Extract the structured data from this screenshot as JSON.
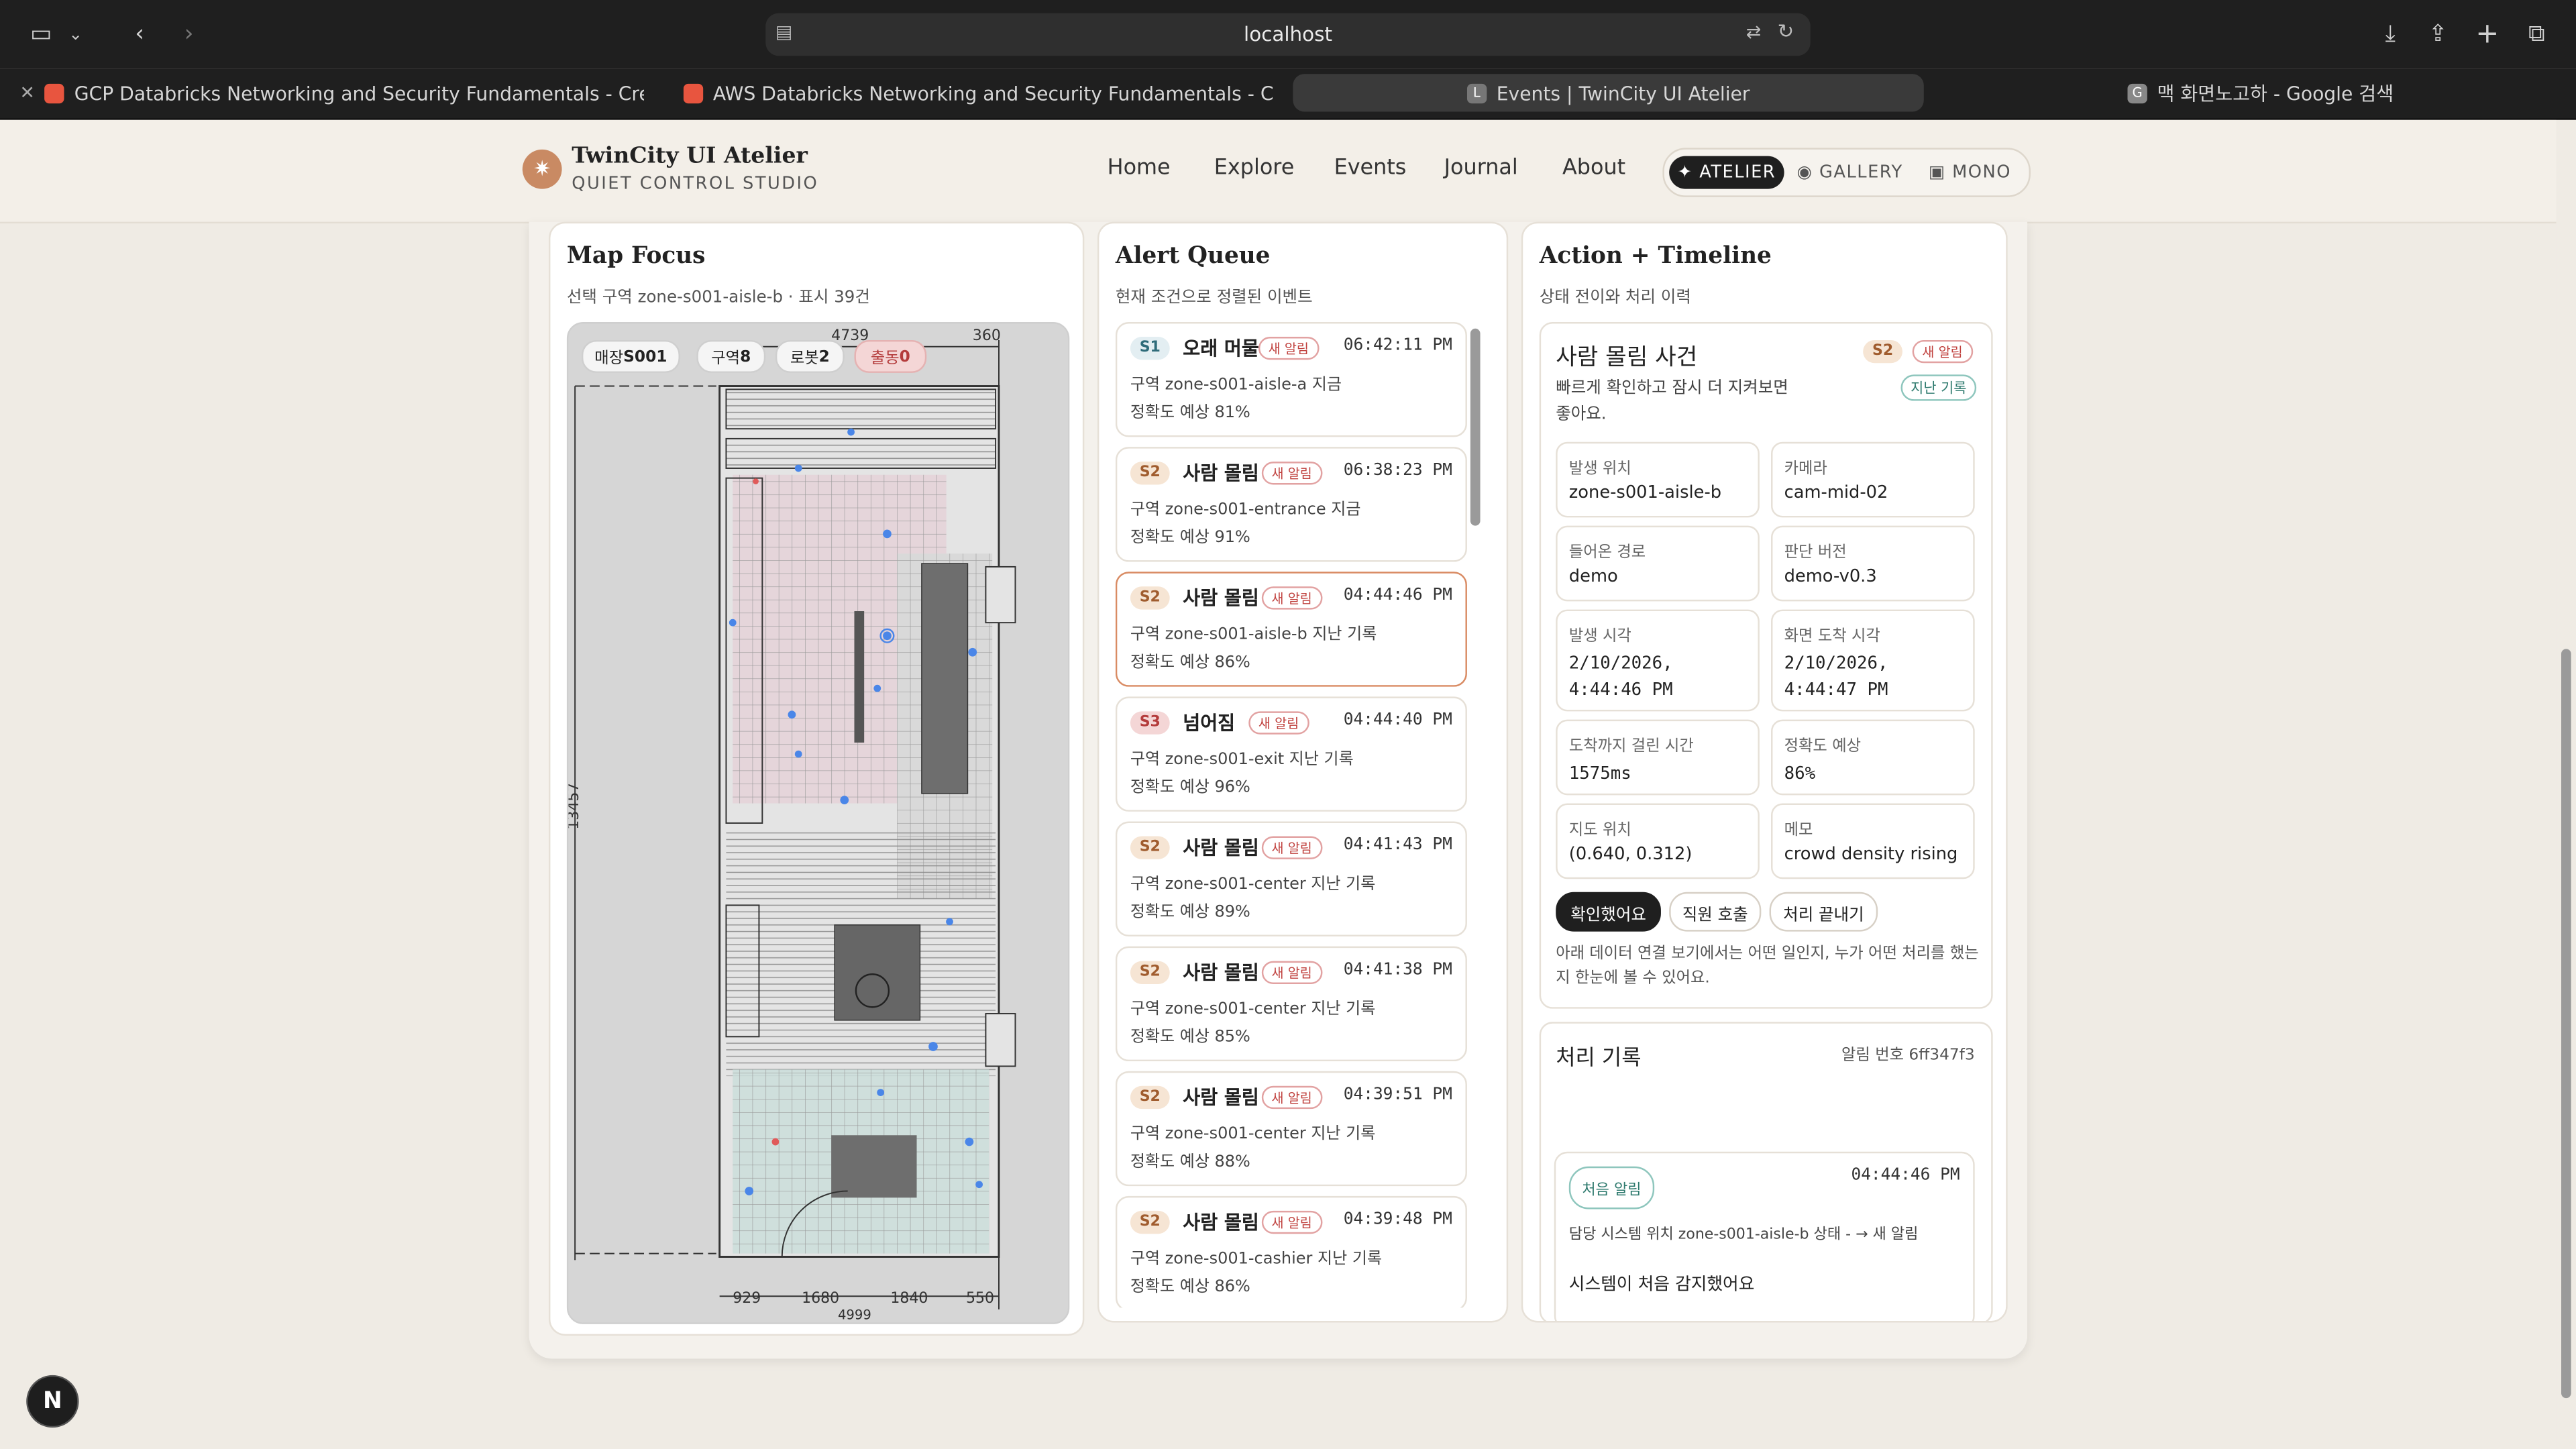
{
  "browser": {
    "url": "localhost",
    "tabs": [
      {
        "title": "GCP Databricks Networking and Security Fundamentals - Creating..."
      },
      {
        "title": "AWS Databricks Networking and Security Fundamentals - Creating..."
      },
      {
        "title": "Events | TwinCity UI Atelier",
        "favicon_letter": "L"
      },
      {
        "title": "맥 화면노고하 - Google 검색",
        "favicon_letter": "G"
      }
    ]
  },
  "nav": {
    "brand_title": "TwinCity UI Atelier",
    "brand_subtitle": "QUIET CONTROL STUDIO",
    "links": [
      "Home",
      "Explore",
      "Events",
      "Journal",
      "About"
    ],
    "themes": [
      {
        "label": "✦ ATELIER"
      },
      {
        "label": "◉ GALLERY"
      },
      {
        "label": "▣ MONO"
      }
    ]
  },
  "map_panel": {
    "title": "Map Focus",
    "subtitle": "선택 구역 zone-s001-aisle-b · 표시 39건",
    "chips": {
      "store_label": "매장",
      "store_value": "S001",
      "zone_label": "구역",
      "zone_value": "8",
      "robot_label": "로봇",
      "robot_value": "2",
      "dispatch_label": "출동",
      "dispatch_value": "0"
    },
    "dims": {
      "top": "4739",
      "top_right": "360",
      "left": "13457",
      "bottom_segments": [
        "929",
        "1680",
        "1840",
        "550"
      ],
      "bottom_total": "4999"
    }
  },
  "queue_panel": {
    "title": "Alert Queue",
    "subtitle": "현재 조건으로 정렬된 이벤트",
    "new_tag": "새 알림",
    "alerts": [
      {
        "severity": "S1",
        "title": "오래 머물",
        "time": "06:42:11 PM",
        "zone": "구역 zone-s001-aisle-a  지금",
        "accuracy": "정확도 예상 81%"
      },
      {
        "severity": "S2",
        "title": "사람 몰림",
        "time": "06:38:23 PM",
        "zone": "구역 zone-s001-entrance  지금",
        "accuracy": "정확도 예상 91%"
      },
      {
        "severity": "S2",
        "title": "사람 몰림",
        "time": "04:44:46 PM",
        "zone": "구역 zone-s001-aisle-b  지난 기록",
        "accuracy": "정확도 예상 86%"
      },
      {
        "severity": "S3",
        "title": "넘어짐",
        "time": "04:44:40 PM",
        "zone": "구역 zone-s001-exit  지난 기록",
        "accuracy": "정확도 예상 96%"
      },
      {
        "severity": "S2",
        "title": "사람 몰림",
        "time": "04:41:43 PM",
        "zone": "구역 zone-s001-center  지난 기록",
        "accuracy": "정확도 예상 89%"
      },
      {
        "severity": "S2",
        "title": "사람 몰림",
        "time": "04:41:38 PM",
        "zone": "구역 zone-s001-center  지난 기록",
        "accuracy": "정확도 예상 85%"
      },
      {
        "severity": "S2",
        "title": "사람 몰림",
        "time": "04:39:51 PM",
        "zone": "구역 zone-s001-center  지난 기록",
        "accuracy": "정확도 예상 88%"
      },
      {
        "severity": "S2",
        "title": "사람 몰림",
        "time": "04:39:48 PM",
        "zone": "구역 zone-s001-cashier  지난 기록",
        "accuracy": "정확도 예상 86%"
      }
    ]
  },
  "action_panel": {
    "title": "Action + Timeline",
    "subtitle": "상태 전이와 처리 이력",
    "incident": {
      "title": "사람 몰림 사건",
      "severity": "S2",
      "new_tag": "새 알림",
      "history_tag": "지난 기록",
      "description": "빠르게 확인하고 잠시 더 지켜보면 좋아요.",
      "fields": [
        {
          "label": "발생 위치",
          "value": "zone-s001-aisle-b"
        },
        {
          "label": "카메라",
          "value": "cam-mid-02"
        },
        {
          "label": "들어온 경로",
          "value": "demo"
        },
        {
          "label": "판단 버전",
          "value": "demo-v0.3"
        },
        {
          "label": "발생 시각",
          "value": "2/10/2026, 4:44:46 PM"
        },
        {
          "label": "화면 도착 시각",
          "value": "2/10/2026, 4:44:47 PM"
        },
        {
          "label": "도착까지 걸린 시간",
          "value": "1575ms"
        },
        {
          "label": "정확도 예상",
          "value": "86%"
        },
        {
          "label": "지도 위치",
          "value": "(0.640, 0.312)"
        },
        {
          "label": "메모",
          "value": "crowd density rising"
        }
      ],
      "buttons": {
        "confirm": "확인했어요",
        "call_staff": "직원 호출",
        "finish": "처리 끝내기"
      },
      "footnote": "아래 데이터 연결 보기에서는 어떤 일인지, 누가 어떤 처리를 했는지 한눈에 볼 수 있어요."
    },
    "log": {
      "title": "처리 기록",
      "alert_id": "알림 번호 6ff347f3",
      "entry": {
        "tag": "처음 알림",
        "time": "04:44:46 PM",
        "detail": "담당 시스템  위치 zone-s001-aisle-b  상태 - → 새 알림",
        "message": "시스템이 처음 감지했어요"
      }
    }
  },
  "dev_badge": "N"
}
